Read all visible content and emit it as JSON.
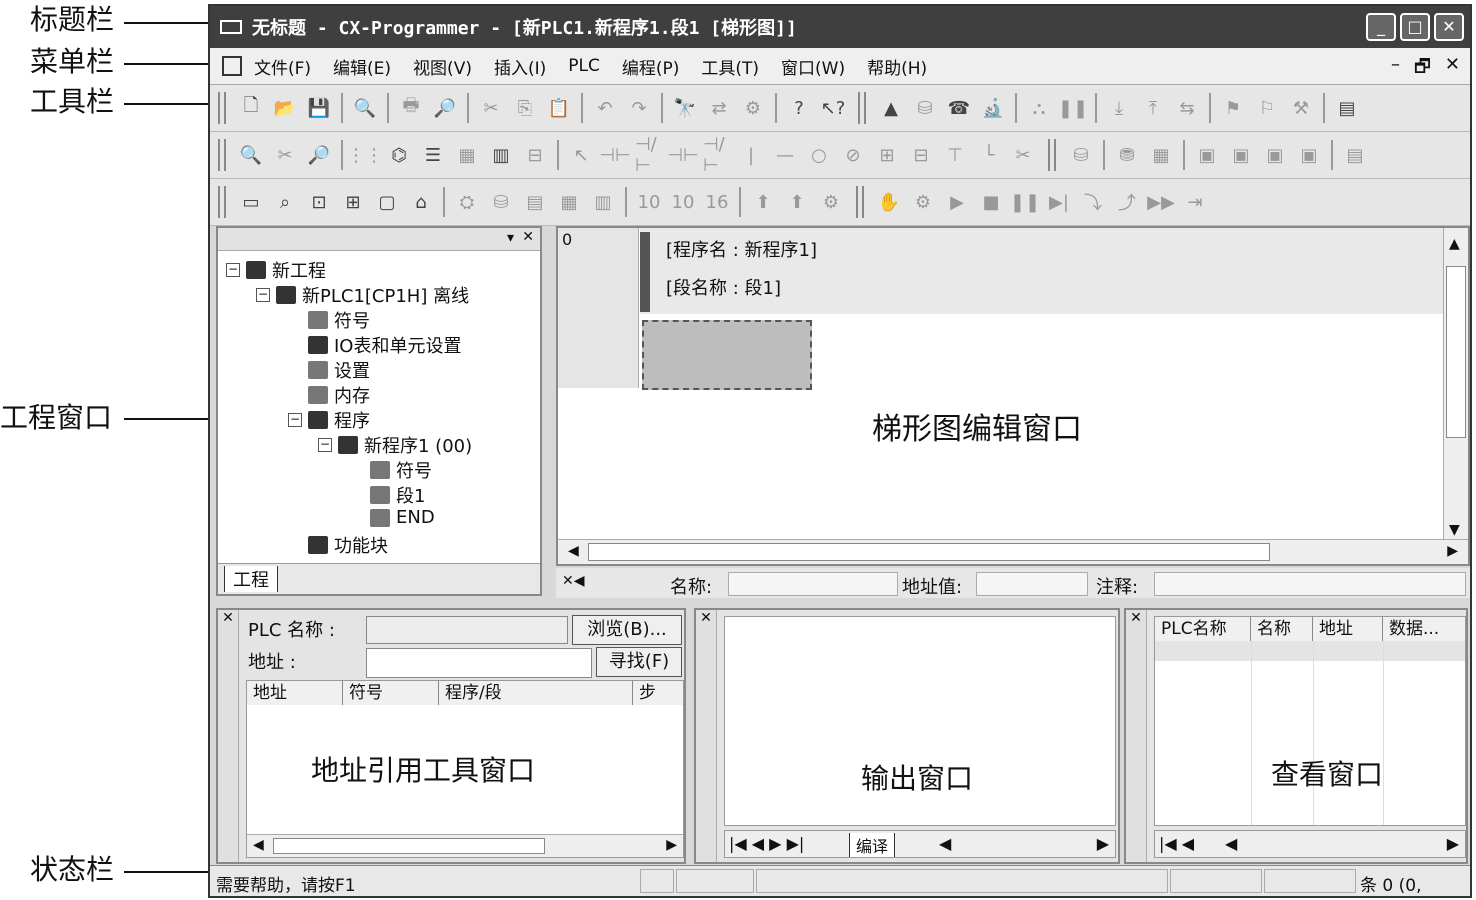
{
  "callouts": {
    "titlebar": "标题栏",
    "menubar": "菜单栏",
    "toolbar": "工具栏",
    "project_window": "工程窗口",
    "statusbar": "状态栏"
  },
  "window": {
    "title": "无标题 - CX-Programmer - [新PLC1.新程序1.段1 [梯形图]]"
  },
  "menu": {
    "items": [
      "文件(F)",
      "编辑(E)",
      "视图(V)",
      "插入(I)",
      "PLC",
      "编程(P)",
      "工具(T)",
      "窗口(W)",
      "帮助(H)"
    ],
    "mdi_buttons": [
      "–",
      "🗗",
      "✕"
    ]
  },
  "project": {
    "tab": "工程",
    "tree": [
      {
        "label": "新工程"
      },
      {
        "label": "新PLC1[CP1H] 离线"
      },
      {
        "label": "符号"
      },
      {
        "label": "IO表和单元设置"
      },
      {
        "label": "设置"
      },
      {
        "label": "内存"
      },
      {
        "label": "程序"
      },
      {
        "label": "新程序1 (00)"
      },
      {
        "label": "符号"
      },
      {
        "label": "段1"
      },
      {
        "label": "END"
      },
      {
        "label": "功能块"
      }
    ]
  },
  "ladder": {
    "rung_number": "0",
    "program_name_line": "[程序名 : 新程序1]",
    "section_name_line": "[段名称 : 段1]",
    "label": "梯形图编辑窗口"
  },
  "infobar": {
    "name_label": "名称:",
    "address_label": "地址值:",
    "comment_label": "注释:"
  },
  "address_tool": {
    "plc_name_label": "PLC 名称 :",
    "address_label": "地址 :",
    "browse_button": "浏览(B)...",
    "find_button": "寻找(F)",
    "columns": [
      "地址",
      "符号",
      "程序/段",
      "步"
    ],
    "label": "地址引用工具窗口"
  },
  "output": {
    "tab": "编译",
    "label": "输出窗口"
  },
  "watch": {
    "columns": [
      "PLC名称",
      "名称",
      "地址",
      "数据..."
    ],
    "label": "查看窗口"
  },
  "statusbar": {
    "help_text": "需要帮助，请按F1",
    "right_text": "条 0 (0,"
  }
}
